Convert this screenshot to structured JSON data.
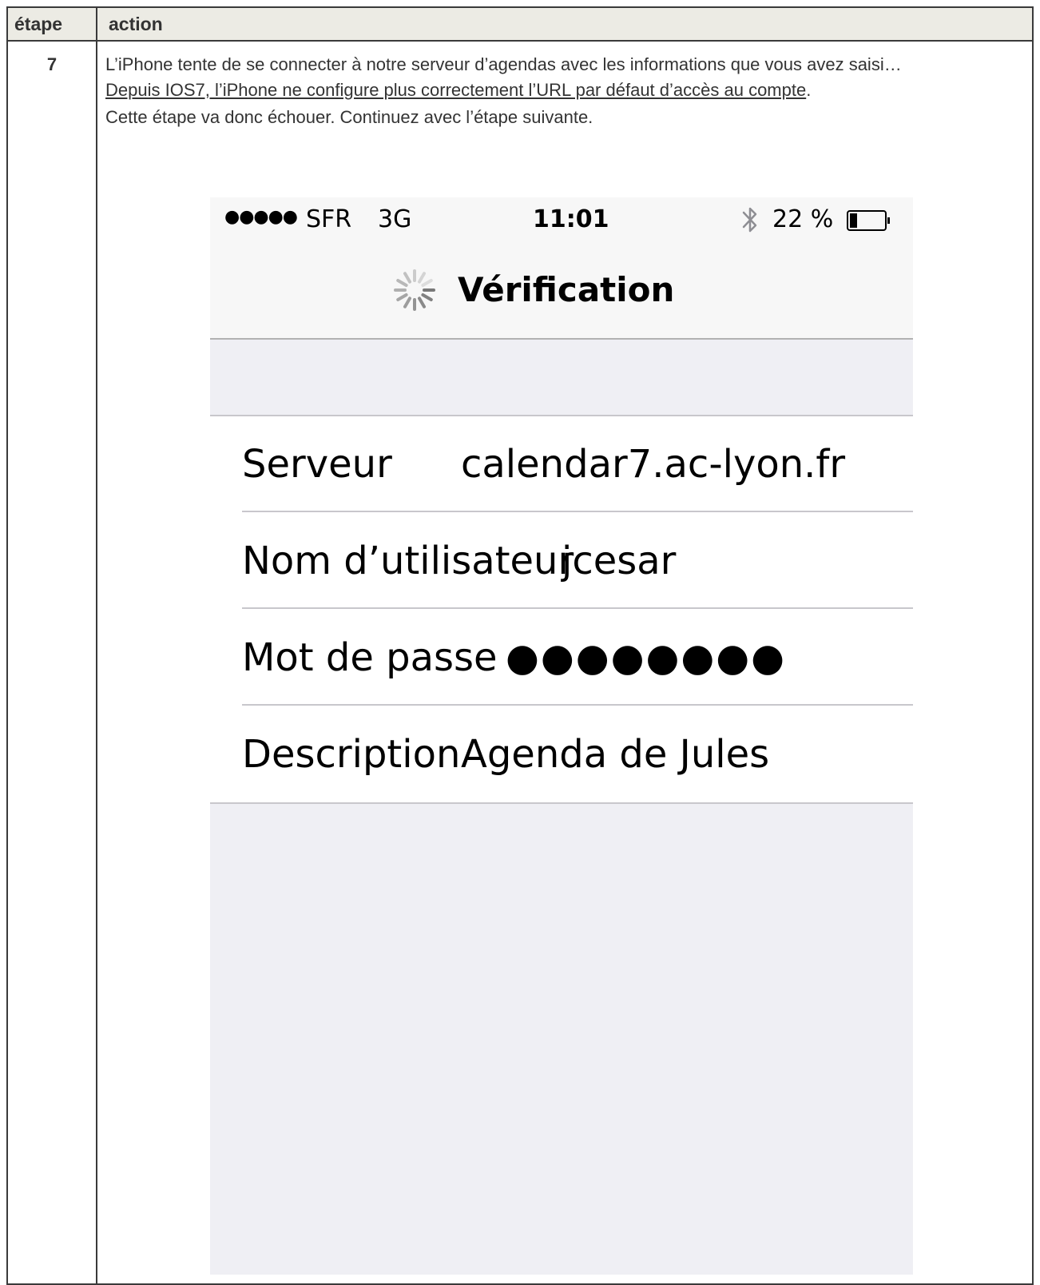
{
  "table": {
    "header_step": "étape",
    "header_action": "action"
  },
  "row": {
    "step_number": "7",
    "line1": "L’iPhone tente de se connecter à notre serveur d’agendas avec les informations que vous avez saisi…",
    "note_underlined": "Depuis IOS7, l’iPhone ne configure plus correctement l’URL par défaut d’accès au compte",
    "note_period": ".",
    "line3": "Cette étape va donc échouer. Continuez avec l’étape suivante."
  },
  "phone": {
    "status_bar": {
      "signal": "●●●●●",
      "carrier": "SFR",
      "network": "3G",
      "time": "11:01",
      "bluetooth_icon": "bluetooth-icon",
      "battery_text": "22 %",
      "battery_level": 0.22
    },
    "nav": {
      "title": "Vérification",
      "spinner_icon": "activity-spinner-icon"
    },
    "form": {
      "server": {
        "label": "Serveur",
        "value": "calendar7.ac-lyon.fr"
      },
      "username": {
        "label": "Nom d’utilisateur",
        "value": "jcesar"
      },
      "password": {
        "label": "Mot de passe",
        "value": "●●●●●●●●"
      },
      "description": {
        "label": "Description",
        "value": "Agenda de Jules"
      }
    }
  }
}
